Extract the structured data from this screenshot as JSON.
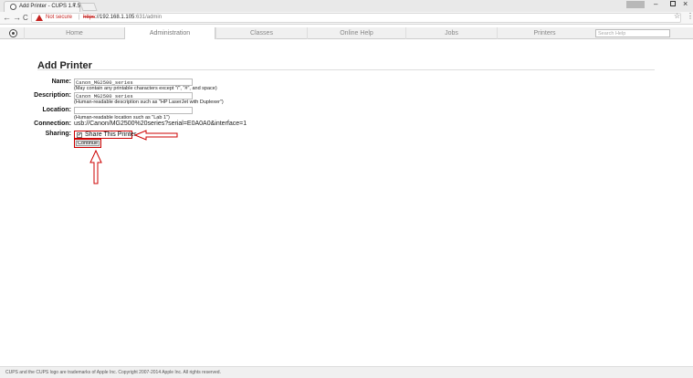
{
  "browser": {
    "tab_title": "Add Printer - CUPS 1.7.5",
    "tab_close": "×",
    "security_label": "Not secure",
    "url_protocol": "https",
    "url_host": "://192.168.1.105",
    "url_path": ":631/admin",
    "window_controls": {
      "minimize": "–",
      "close": "×"
    },
    "star_glyph": "☆",
    "menu_glyph": "⋮",
    "back_glyph": "←",
    "forward_glyph": "→",
    "reload_glyph": "C"
  },
  "cups_nav": {
    "items": [
      {
        "label": "Home",
        "active": false
      },
      {
        "label": "Administration",
        "active": true
      },
      {
        "label": "Classes",
        "active": false
      },
      {
        "label": "Online Help",
        "active": false
      },
      {
        "label": "Jobs",
        "active": false
      },
      {
        "label": "Printers",
        "active": false
      }
    ],
    "search_placeholder": "Search Help"
  },
  "page": {
    "title": "Add Printer",
    "form": {
      "name_label": "Name:",
      "name_value": "Canon_MG2500_series",
      "name_hint": "(May contain any printable characters except \"/\", \"#\", and space)",
      "description_label": "Description:",
      "description_value": "Canon MG2500 series",
      "description_hint": "(Human-readable description such as \"HP LaserJet with Duplexer\")",
      "location_label": "Location:",
      "location_value": "",
      "location_hint": "(Human-readable location such as \"Lab 1\")",
      "connection_label": "Connection:",
      "connection_value": "usb://Canon/MG2500%20series?serial=E0A0A0&interface=1",
      "sharing_label": "Sharing:",
      "share_checked": true,
      "share_text": "Share This Printer",
      "continue_label": "Continue"
    }
  },
  "footer": {
    "text": "CUPS and the CUPS logo are trademarks of Apple Inc. Copyright 2007-2014 Apple Inc. All rights reserved."
  },
  "colors": {
    "annotation_red": "#cc0000",
    "warning_red": "#c5221f"
  }
}
